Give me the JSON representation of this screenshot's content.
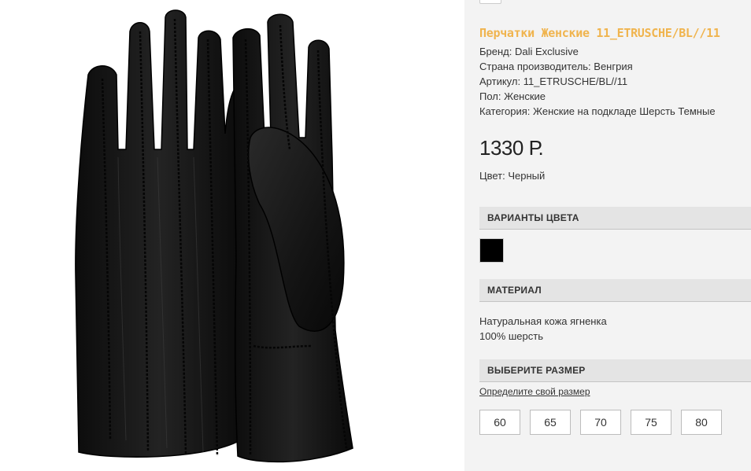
{
  "product": {
    "title": "Перчатки Женские 11_ETRUSCHE/BL//11",
    "info": [
      "Бренд: Dali Exclusive",
      "Страна производитель: Венгрия",
      "Артикул: 11_ETRUSCHE/BL//11",
      "Пол: Женские",
      "Категория: Женские на подкладе Шерсть Темные"
    ],
    "price": "1330 Р.",
    "color_line": "Цвет: Черный"
  },
  "sections": {
    "colors_header": "ВАРИАНТЫ ЦВЕТА",
    "material_header": "МАТЕРИАЛ",
    "material_lines": [
      "Натуральная кожа ягненка",
      "100% шерсть"
    ],
    "size_header": "ВЫБЕРИТЕ РАЗМЕР",
    "size_link": "Определите свой размер",
    "sizes": [
      "60",
      "65",
      "70",
      "75",
      "80"
    ]
  },
  "swatch_color": "#000000",
  "image": {
    "subject": "black-leather-gloves"
  }
}
